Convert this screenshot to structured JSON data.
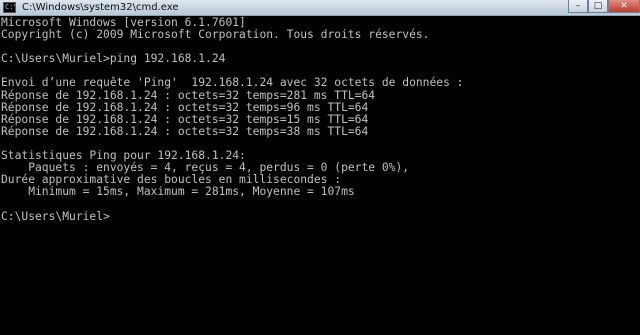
{
  "window": {
    "title": "C:\\Windows\\system32\\cmd.exe",
    "icon_text": "C:\\",
    "controls": {
      "minimize": "–",
      "maximize": "□",
      "close": "✕"
    }
  },
  "console": {
    "lines": [
      "Microsoft Windows [version 6.1.7601]",
      "Copyright (c) 2009 Microsoft Corporation. Tous droits réservés.",
      "",
      "C:\\Users\\Muriel>ping 192.168.1.24",
      "",
      "Envoi d’une requête 'Ping'  192.168.1.24 avec 32 octets de données :",
      "Réponse de 192.168.1.24 : octets=32 temps=281 ms TTL=64",
      "Réponse de 192.168.1.24 : octets=32 temps=96 ms TTL=64",
      "Réponse de 192.168.1.24 : octets=32 temps=15 ms TTL=64",
      "Réponse de 192.168.1.24 : octets=32 temps=38 ms TTL=64",
      "",
      "Statistiques Ping pour 192.168.1.24:",
      "    Paquets : envoyés = 4, reçus = 4, perdus = 0 (perte 0%),",
      "Durée approximative des boucles en millisecondes :",
      "    Minimum = 15ms, Maximum = 281ms, Moyenne = 107ms",
      "",
      "C:\\Users\\Muriel>"
    ]
  },
  "colors": {
    "background": "#000000",
    "text": "#c0c0c0",
    "close_button": "#c0392b"
  }
}
